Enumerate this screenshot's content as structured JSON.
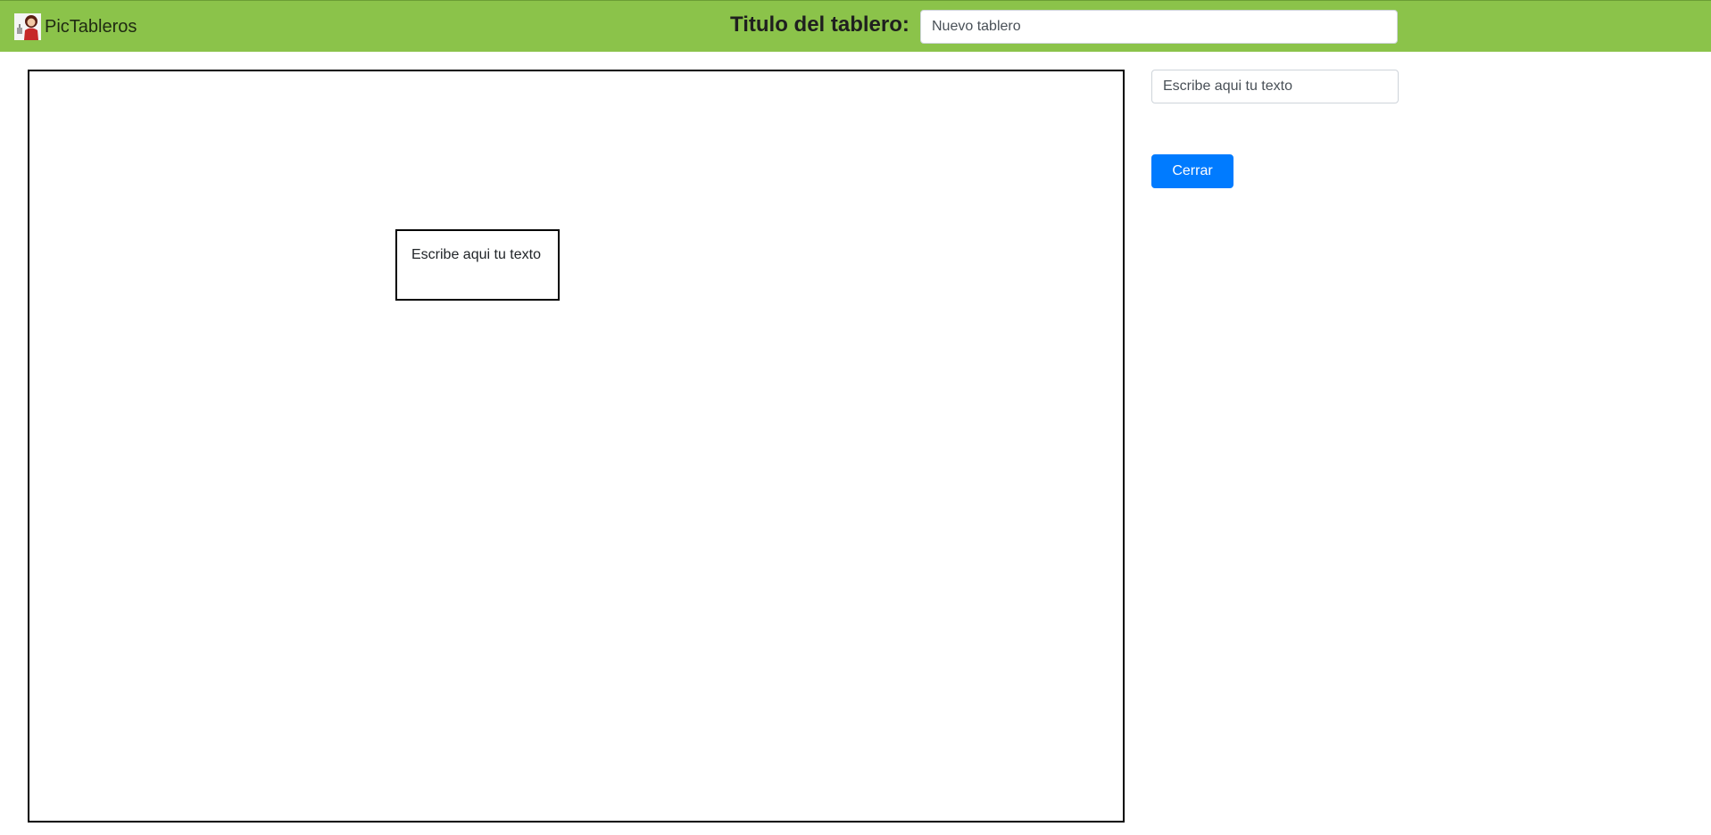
{
  "app": {
    "brand_name": "PicTableros",
    "logo_icon": "girl-avatar-icon"
  },
  "header": {
    "title_label": "Titulo del tablero:",
    "title_input_value": "Nuevo tablero"
  },
  "board": {
    "text_box_content": "Escribe aqui tu texto"
  },
  "side_panel": {
    "text_input_value": "Escribe aqui tu texto",
    "close_label": "Cerrar"
  },
  "colors": {
    "navbar": "#8bc34a",
    "button_primary": "#007bff"
  }
}
